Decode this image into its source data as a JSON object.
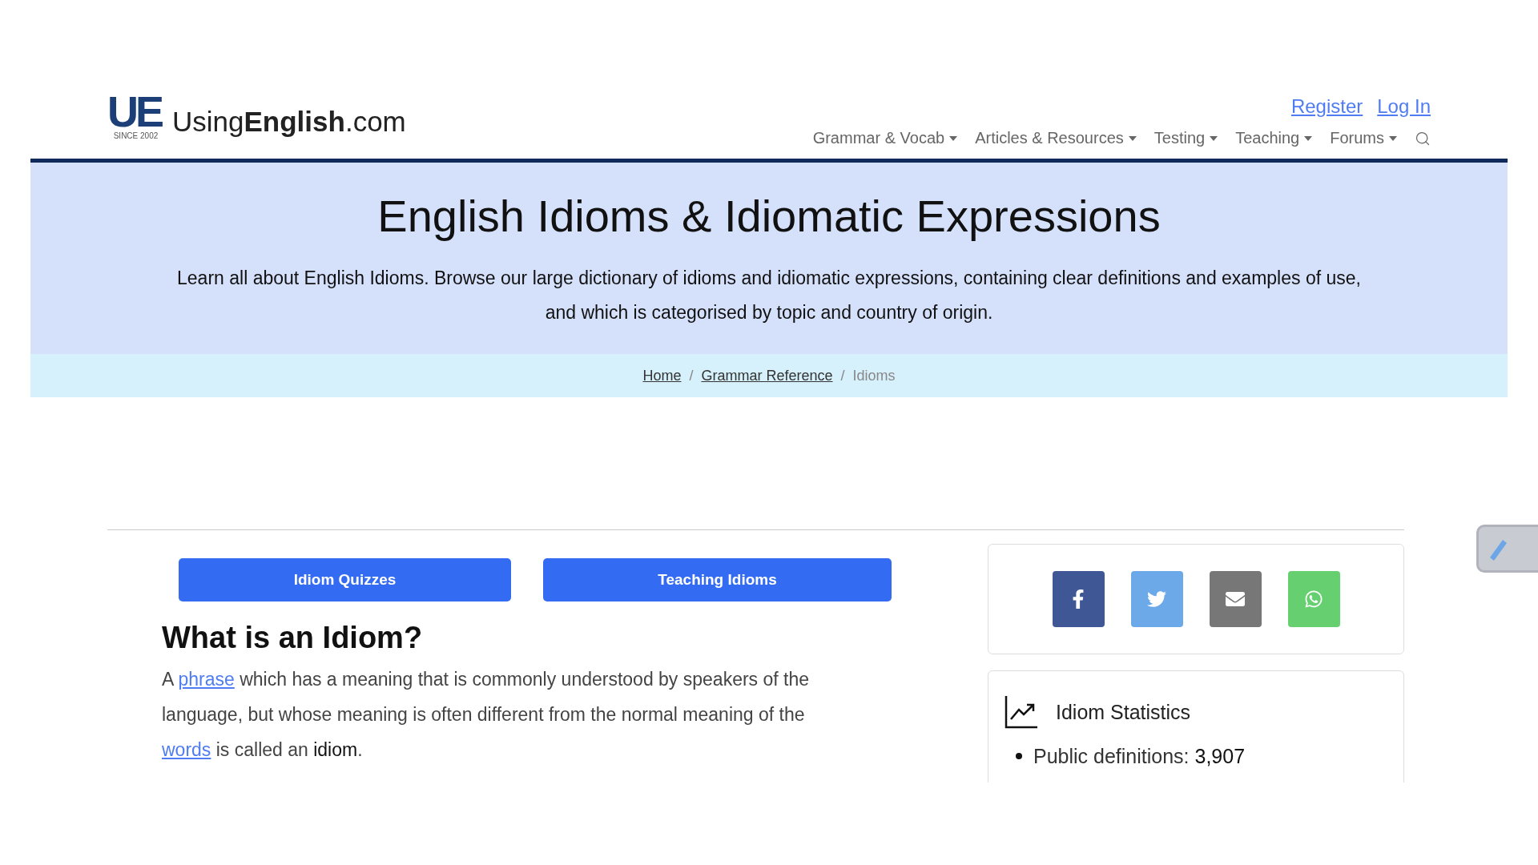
{
  "logo": {
    "mark": "UE",
    "since": "SINCE 2002",
    "name": "Using**English**.com"
  },
  "account_links": [
    "Register",
    "Log In"
  ],
  "nav": [
    {
      "label": "Grammar & Vocab"
    },
    {
      "label": "Articles & Resources"
    },
    {
      "label": "Testing"
    },
    {
      "label": "Teaching"
    },
    {
      "label": "Forums"
    }
  ],
  "hero": {
    "title": "English Idioms & Idiomatic Expressions",
    "text": "Learn all about English Idioms. Browse our large dictionary of idioms and idiomatic expressions, containing clear definitions and examples of use, and which is categorised by topic and country of origin."
  },
  "breadcrumb": [
    {
      "kind": "link",
      "label": "Home"
    },
    {
      "kind": "separator",
      "label": "/"
    },
    {
      "kind": "link",
      "label": "Grammar Reference"
    },
    {
      "kind": "separator",
      "label": "/"
    },
    {
      "kind": "current",
      "label": "Idioms"
    }
  ],
  "buttons": [
    "Idiom Quizzes",
    "Teaching Idioms"
  ],
  "section": {
    "heading": "What is an Idiom?",
    "paragraph": [
      {
        "kind": "text",
        "text": "A "
      },
      {
        "kind": "link",
        "text": "phrase"
      },
      {
        "kind": "text",
        "text": " which has a meaning that is commonly understood by speakers of the language, but whose meaning is often different from the normal meaning of the "
      },
      {
        "kind": "link",
        "text": "words"
      },
      {
        "kind": "text",
        "text": " is called an "
      },
      {
        "kind": "strong",
        "text": "idiom"
      },
      {
        "kind": "text",
        "text": "."
      }
    ]
  },
  "share": [
    {
      "kind": "facebook",
      "color": "#3f5895"
    },
    {
      "kind": "twitter",
      "color": "#6ca9e8"
    },
    {
      "kind": "email",
      "color": "#777777"
    },
    {
      "kind": "whatsapp",
      "color": "#66d071"
    }
  ],
  "stats": {
    "title": "Idiom Statistics",
    "items": [
      {
        "label": "Public definitions: ",
        "value": "3,907"
      }
    ]
  }
}
